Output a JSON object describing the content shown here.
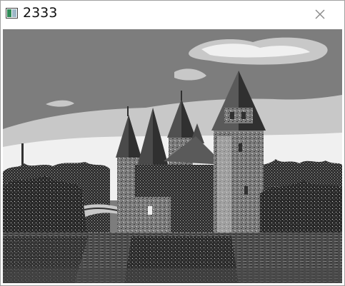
{
  "window": {
    "title": "2333",
    "app_icon": "image-window-icon",
    "close_icon": "close-icon"
  },
  "image": {
    "description_icon": "castle-photo",
    "palette": {
      "dark": "#303030",
      "mid": "#7d7d7d",
      "light": "#c8c8c8",
      "white": "#f4f4f4"
    }
  }
}
